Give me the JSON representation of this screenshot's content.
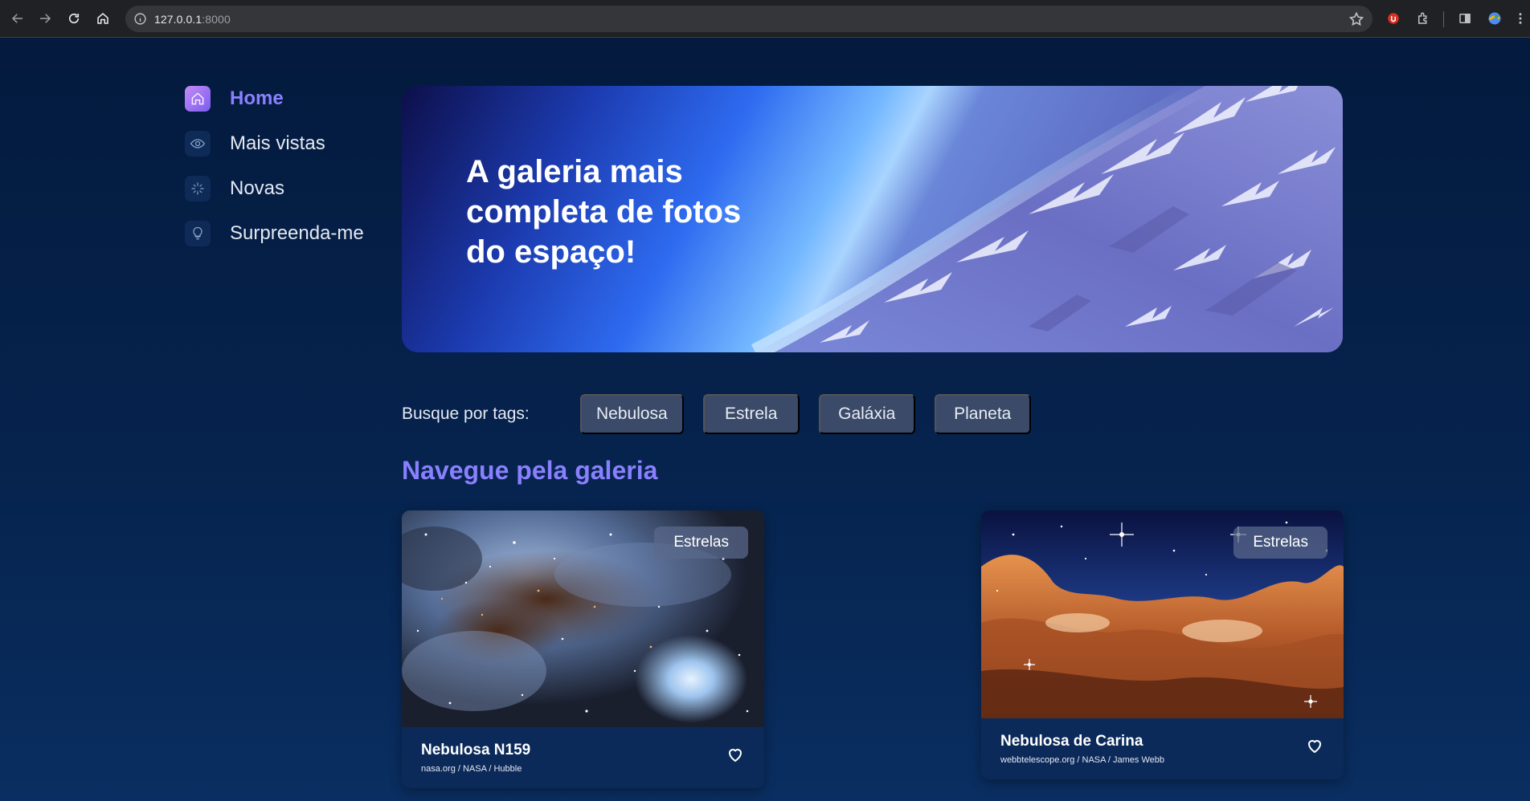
{
  "browser": {
    "url_host": "127.0.0.1",
    "url_port": ":8000"
  },
  "sidebar": {
    "items": [
      {
        "label": "Home",
        "icon": "home-icon",
        "active": true
      },
      {
        "label": "Mais vistas",
        "icon": "eye-icon",
        "active": false
      },
      {
        "label": "Novas",
        "icon": "sparkle-icon",
        "active": false
      },
      {
        "label": "Surpreenda-me",
        "icon": "lightbulb-icon",
        "active": false
      }
    ]
  },
  "banner": {
    "title": "A galeria mais completa de fotos do espaço!"
  },
  "tags": {
    "label": "Busque por tags:",
    "items": [
      "Nebulosa",
      "Estrela",
      "Galáxia",
      "Planeta"
    ]
  },
  "gallery": {
    "title": "Navegue pela galeria",
    "cards": [
      {
        "badge": "Estrelas",
        "title": "Nebulosa N159",
        "credit": "nasa.org / NASA / Hubble"
      },
      {
        "badge": "Estrelas",
        "title": "Nebulosa de Carina",
        "credit": "webbtelescope.org / NASA / James Webb"
      }
    ]
  },
  "colors": {
    "accent": "#8a80ff",
    "background": "#041a3e",
    "tag_bg": "#3a4a68",
    "card_bg": "#0b2a5a"
  }
}
